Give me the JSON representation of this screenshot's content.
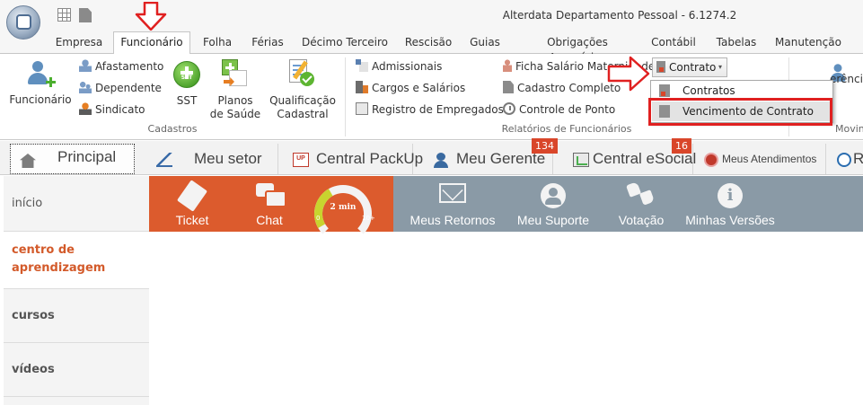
{
  "window": {
    "title": "Alterdata Departamento Pessoal - 6.1274.2"
  },
  "tabs": [
    {
      "label": "Empresa"
    },
    {
      "label": "Funcionário"
    },
    {
      "label": "Folha"
    },
    {
      "label": "Férias"
    },
    {
      "label": "Décimo Terceiro"
    },
    {
      "label": "Rescisão"
    },
    {
      "label": "Guias"
    },
    {
      "label": "Obrigações Acessórias"
    },
    {
      "label": "Contábil"
    },
    {
      "label": "Tabelas"
    },
    {
      "label": "Manutenção"
    }
  ],
  "ribbon": {
    "cadastros": {
      "label": "Cadastros",
      "funcionario": "Funcionário",
      "afastamento": "Afastamento",
      "dependente": "Dependente",
      "sindicato": "Sindicato",
      "sst": "SST",
      "sst_badge": "SST",
      "planos_line1": "Planos",
      "planos_line2": "de Saúde",
      "qual_line1": "Qualificação",
      "qual_line2": "Cadastral"
    },
    "relatorios": {
      "label": "Relatórios de Funcionários",
      "admissionais": "Admissionais",
      "cargos": "Cargos e Salários",
      "registro": "Registro de Empregados",
      "ficha": "Ficha Salário Maternidade",
      "cadastro": "Cadastro Completo",
      "controle": "Controle de Ponto",
      "contrato": "Contrato"
    },
    "next_group": {
      "label_partial": "Movin",
      "button_partial": "erênci"
    }
  },
  "contrato_menu": {
    "items": [
      {
        "label": "Contratos"
      },
      {
        "label": "Vencimento de Contrato"
      }
    ]
  },
  "portal_tabs": [
    {
      "label": "Principal"
    },
    {
      "label": "Meu setor"
    },
    {
      "label": "Central PackUp",
      "icon_text": "UP"
    },
    {
      "label": "Meu Gerente",
      "badge": "134"
    },
    {
      "label": "Central eSocial",
      "badge": "16"
    },
    {
      "label": "Meus Atendimentos"
    },
    {
      "label": "R"
    }
  ],
  "sidebar": {
    "items": [
      {
        "label": "início"
      },
      {
        "label_line1": "centro de",
        "label_line2": "aprendizagem"
      },
      {
        "label": "cursos"
      },
      {
        "label": "vídeos"
      }
    ]
  },
  "actions": {
    "ticket": "Ticket",
    "chat": "Chat",
    "gauge_value": "2 min",
    "gauge_min": "0",
    "gauge_max": "10+",
    "retornos": "Meus Retornos",
    "suporte": "Meu Suporte",
    "votacao": "Votação",
    "versoes": "Minhas Versões",
    "info_glyph": "i"
  },
  "colors": {
    "accent_orange": "#dc5b2d",
    "panel_grey": "#8a9aa6",
    "annotation_red": "#e02020",
    "badge_red": "#d9462a"
  }
}
